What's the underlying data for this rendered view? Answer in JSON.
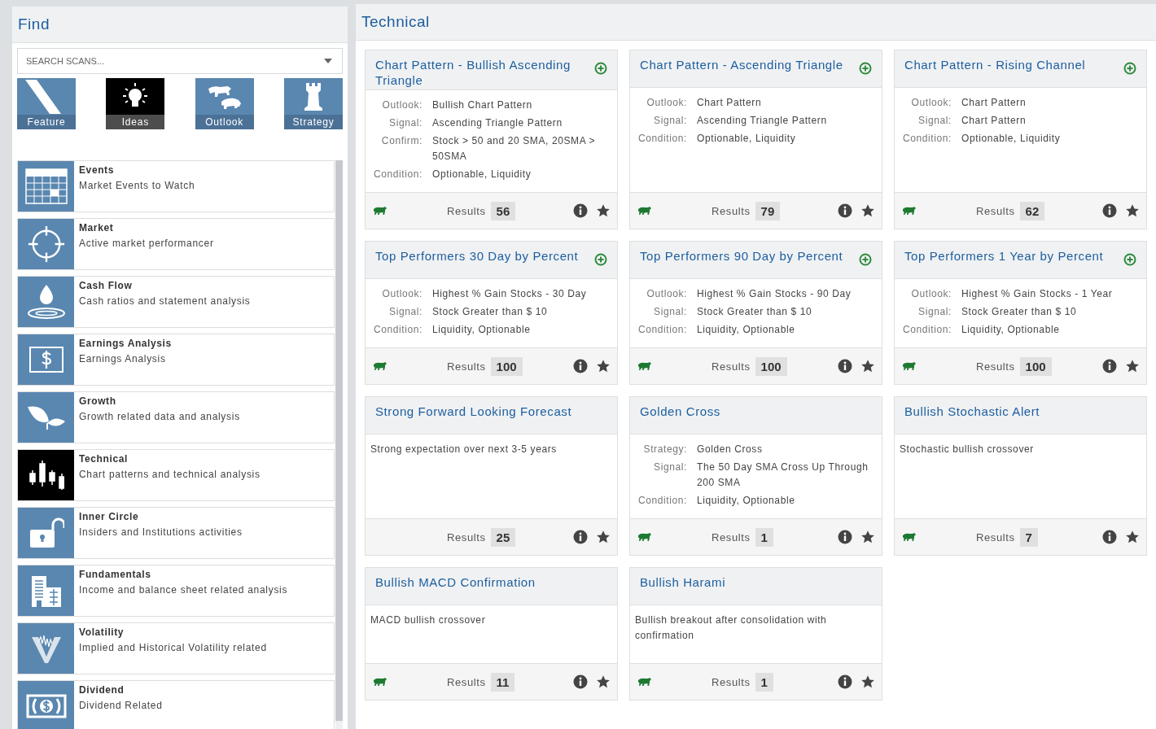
{
  "find_panel": {
    "title": "Find",
    "search": {
      "placeholder": "SEARCH SCANS..."
    },
    "tiles": [
      {
        "label": "Feature",
        "selected": false
      },
      {
        "label": "Ideas",
        "selected": true
      },
      {
        "label": "Outlook",
        "selected": false
      },
      {
        "label": "Strategy",
        "selected": false
      }
    ],
    "categories": [
      {
        "title": "Events",
        "subtitle": "Market Events to Watch",
        "selected": false
      },
      {
        "title": "Market",
        "subtitle": "Active market performancer",
        "selected": false
      },
      {
        "title": "Cash Flow",
        "subtitle": "Cash ratios and statement analysis",
        "selected": false
      },
      {
        "title": "Earnings Analysis",
        "subtitle": "Earnings Analysis",
        "selected": false
      },
      {
        "title": "Growth",
        "subtitle": "Growth related data and analysis",
        "selected": false
      },
      {
        "title": "Technical",
        "subtitle": "Chart patterns and technical analysis",
        "selected": true
      },
      {
        "title": "Inner Circle",
        "subtitle": "Insiders and Institutions activities",
        "selected": false
      },
      {
        "title": "Fundamentals",
        "subtitle": "Income and balance sheet related analysis",
        "selected": false
      },
      {
        "title": "Volatility",
        "subtitle": "Implied and Historical Volatility related",
        "selected": false
      },
      {
        "title": "Dividend",
        "subtitle": "Dividend Related",
        "selected": false
      }
    ]
  },
  "results_panel": {
    "title": "Technical",
    "cards": [
      {
        "title": "Chart Pattern - Bullish Ascending Triangle",
        "add": true,
        "kind": "details",
        "details": [
          {
            "label": "Outlook:",
            "value": "Bullish Chart Pattern"
          },
          {
            "label": "Signal:",
            "value": "Ascending Triangle Pattern"
          },
          {
            "label": "Confirm:",
            "value": "Stock > 50 and 20 SMA, 20SMA > 50SMA"
          },
          {
            "label": "Condition:",
            "value": "Optionable, Liquidity"
          }
        ],
        "bull": true,
        "results_label": "Results",
        "results": "56"
      },
      {
        "title": "Chart Pattern - Ascending Triangle",
        "add": true,
        "kind": "details",
        "details": [
          {
            "label": "Outlook:",
            "value": "Chart Pattern"
          },
          {
            "label": "Signal:",
            "value": "Ascending Triangle Pattern"
          },
          {
            "label": "Condition:",
            "value": "Optionable, Liquidity"
          }
        ],
        "bull": true,
        "results_label": "Results",
        "results": "79"
      },
      {
        "title": "Chart Pattern - Rising Channel",
        "add": true,
        "kind": "details",
        "details": [
          {
            "label": "Outlook:",
            "value": "Chart Pattern"
          },
          {
            "label": "Signal:",
            "value": "Chart Pattern"
          },
          {
            "label": "Condition:",
            "value": "Optionable, Liquidity"
          }
        ],
        "bull": true,
        "results_label": "Results",
        "results": "62"
      },
      {
        "title": "Top Performers 30 Day by Percent",
        "add": true,
        "kind": "details",
        "details": [
          {
            "label": "Outlook:",
            "value": "Highest % Gain Stocks - 30 Day"
          },
          {
            "label": "Signal:",
            "value": "Stock Greater than $ 10"
          },
          {
            "label": "Condition:",
            "value": "Liquidity, Optionable"
          }
        ],
        "bull": true,
        "results_label": "Results",
        "results": "100"
      },
      {
        "title": "Top Performers 90 Day by Percent",
        "add": true,
        "kind": "details",
        "details": [
          {
            "label": "Outlook:",
            "value": "Highest % Gain Stocks - 90 Day"
          },
          {
            "label": "Signal:",
            "value": "Stock Greater than $ 10"
          },
          {
            "label": "Condition:",
            "value": "Liquidity, Optionable"
          }
        ],
        "bull": true,
        "results_label": "Results",
        "results": "100"
      },
      {
        "title": "Top Performers 1 Year by Percent",
        "add": true,
        "kind": "details",
        "details": [
          {
            "label": "Outlook:",
            "value": "Highest % Gain Stocks - 1 Year"
          },
          {
            "label": "Signal:",
            "value": "Stock Greater than $ 10"
          },
          {
            "label": "Condition:",
            "value": "Liquidity, Optionable"
          }
        ],
        "bull": true,
        "results_label": "Results",
        "results": "100"
      },
      {
        "title": "Strong Forward Looking Forecast",
        "add": false,
        "kind": "description",
        "description": "Strong expectation over next 3-5 years",
        "bull": false,
        "results_label": "Results",
        "results": "25"
      },
      {
        "title": "Golden Cross",
        "add": false,
        "kind": "details",
        "details": [
          {
            "label": "Strategy:",
            "value": "Golden Cross"
          },
          {
            "label": "Signal:",
            "value": "The 50 Day SMA Cross Up Through 200 SMA"
          },
          {
            "label": "Condition:",
            "value": "Liquidity, Optionable"
          }
        ],
        "bull": true,
        "results_label": "Results",
        "results": "1"
      },
      {
        "title": "Bullish Stochastic Alert",
        "add": false,
        "kind": "description",
        "description": "Stochastic bullish crossover",
        "bull": true,
        "results_label": "Results",
        "results": "7"
      },
      {
        "title": "Bullish MACD Confirmation",
        "add": false,
        "kind": "description",
        "description": "MACD bullish crossover",
        "bull": true,
        "results_label": "Results",
        "results": "11"
      },
      {
        "title": "Bullish Harami",
        "add": false,
        "kind": "description",
        "description": "Bullish breakout after consolidation with confirmation",
        "bull": true,
        "results_label": "Results",
        "results": "1"
      }
    ]
  }
}
